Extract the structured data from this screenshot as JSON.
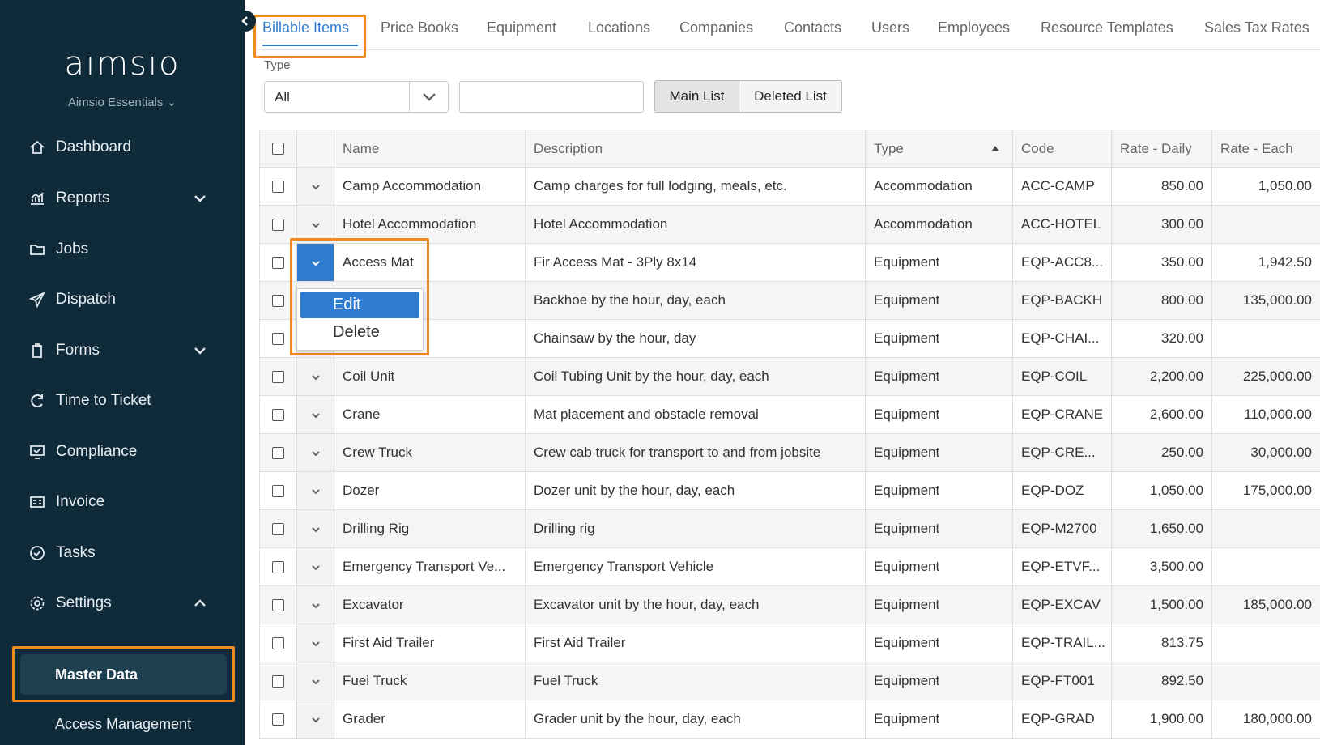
{
  "sidebar": {
    "logo": "aımsıo",
    "org": "Aimsio Essentials",
    "items": [
      {
        "label": "Dashboard",
        "icon": "home-icon"
      },
      {
        "label": "Reports",
        "icon": "chart-icon"
      },
      {
        "label": "Jobs",
        "icon": "folder-icon"
      },
      {
        "label": "Dispatch",
        "icon": "paper-plane-icon"
      },
      {
        "label": "Forms",
        "icon": "clipboard-icon"
      },
      {
        "label": "Time to Ticket",
        "icon": "refresh-icon"
      },
      {
        "label": "Compliance",
        "icon": "monitor-check-icon"
      },
      {
        "label": "Invoice",
        "icon": "invoice-icon"
      },
      {
        "label": "Tasks",
        "icon": "check-circle-icon"
      },
      {
        "label": "Settings",
        "icon": "gear-icon"
      }
    ],
    "sub_active": "Master Data",
    "sub_next": "Access Management"
  },
  "tabs": [
    "Billable Items",
    "Price Books",
    "Equipment",
    "Locations",
    "Companies",
    "Contacts",
    "Users",
    "Employees",
    "Resource Templates",
    "Sales Tax Rates"
  ],
  "filter": {
    "type_label": "Type",
    "type_value": "All",
    "search_value": "",
    "main_list": "Main List",
    "deleted_list": "Deleted List"
  },
  "table": {
    "headers": {
      "name": "Name",
      "description": "Description",
      "type": "Type",
      "code": "Code",
      "rate_daily": "Rate - Daily",
      "rate_each": "Rate - Each"
    },
    "rows": [
      {
        "name": "Camp Accommodation",
        "description": "Camp charges for full lodging, meals, etc.",
        "type": "Accommodation",
        "code": "ACC-CAMP",
        "rate_daily": "850.00",
        "rate_each": "1,050.00"
      },
      {
        "name": "Hotel Accommodation",
        "description": "Hotel Accommodation",
        "type": "Accommodation",
        "code": "ACC-HOTEL",
        "rate_daily": "300.00",
        "rate_each": ""
      },
      {
        "name": "Access Mat",
        "description": "Fir Access Mat - 3Ply 8x14",
        "type": "Equipment",
        "code": "EQP-ACC8...",
        "rate_daily": "350.00",
        "rate_each": "1,942.50"
      },
      {
        "name": "",
        "description": "Backhoe by the hour, day, each",
        "type": "Equipment",
        "code": "EQP-BACKH",
        "rate_daily": "800.00",
        "rate_each": "135,000.00"
      },
      {
        "name": "",
        "description": "Chainsaw by the hour, day",
        "type": "Equipment",
        "code": "EQP-CHAI...",
        "rate_daily": "320.00",
        "rate_each": ""
      },
      {
        "name": "Coil Unit",
        "description": "Coil Tubing Unit by the hour, day, each",
        "type": "Equipment",
        "code": "EQP-COIL",
        "rate_daily": "2,200.00",
        "rate_each": "225,000.00"
      },
      {
        "name": "Crane",
        "description": "Mat placement and obstacle removal",
        "type": "Equipment",
        "code": "EQP-CRANE",
        "rate_daily": "2,600.00",
        "rate_each": "110,000.00"
      },
      {
        "name": "Crew Truck",
        "description": "Crew cab truck for transport to and from jobsite",
        "type": "Equipment",
        "code": "EQP-CRE...",
        "rate_daily": "250.00",
        "rate_each": "30,000.00"
      },
      {
        "name": "Dozer",
        "description": "Dozer unit by the hour, day, each",
        "type": "Equipment",
        "code": "EQP-DOZ",
        "rate_daily": "1,050.00",
        "rate_each": "175,000.00"
      },
      {
        "name": "Drilling Rig",
        "description": "Drilling rig",
        "type": "Equipment",
        "code": "EQP-M2700",
        "rate_daily": "1,650.00",
        "rate_each": ""
      },
      {
        "name": "Emergency Transport Ve...",
        "description": "Emergency Transport Vehicle",
        "type": "Equipment",
        "code": "EQP-ETVF...",
        "rate_daily": "3,500.00",
        "rate_each": ""
      },
      {
        "name": "Excavator",
        "description": "Excavator unit by the hour, day, each",
        "type": "Equipment",
        "code": "EQP-EXCAV",
        "rate_daily": "1,500.00",
        "rate_each": "185,000.00"
      },
      {
        "name": "First Aid Trailer",
        "description": "First Aid Trailer",
        "type": "Equipment",
        "code": "EQP-TRAIL...",
        "rate_daily": "813.75",
        "rate_each": ""
      },
      {
        "name": "Fuel Truck",
        "description": "Fuel Truck",
        "type": "Equipment",
        "code": "EQP-FT001",
        "rate_daily": "892.50",
        "rate_each": ""
      },
      {
        "name": "Grader",
        "description": "Grader unit by the hour, day, each",
        "type": "Equipment",
        "code": "EQP-GRAD",
        "rate_daily": "1,900.00",
        "rate_each": "180,000.00"
      }
    ]
  },
  "row_menu": {
    "edit": "Edit",
    "delete": "Delete"
  },
  "colors": {
    "sidebar_bg": "#0f2b3a",
    "accent": "#2f7bd0",
    "highlight": "#f08a1c"
  }
}
